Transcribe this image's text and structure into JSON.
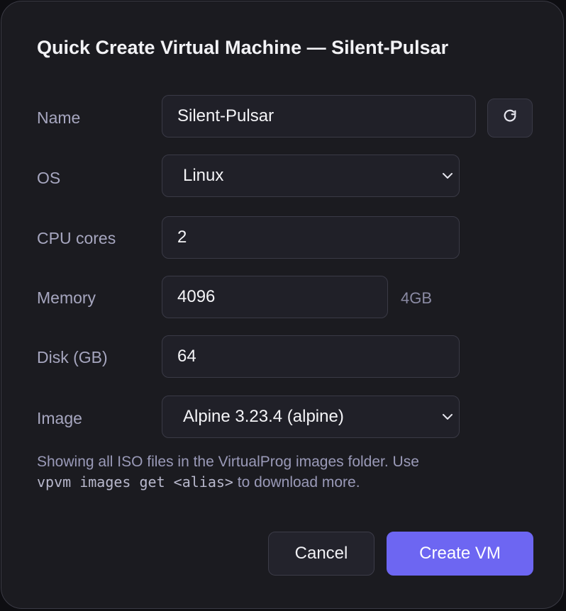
{
  "dialog": {
    "title": "Quick Create Virtual Machine — Silent-Pulsar"
  },
  "form": {
    "name": {
      "label": "Name",
      "value": "Silent-Pulsar"
    },
    "os": {
      "label": "OS",
      "value": "Linux"
    },
    "cpu": {
      "label": "CPU cores",
      "value": "2"
    },
    "memory": {
      "label": "Memory",
      "value": "4096",
      "unit": "4GB"
    },
    "disk": {
      "label": "Disk (GB)",
      "value": "64"
    },
    "image": {
      "label": "Image",
      "value": "Alpine 3.23.4 (alpine)"
    }
  },
  "help": {
    "text_before": "Showing all ISO files in the VirtualProg images folder. Use",
    "command": "vpvm images get <alias>",
    "text_after": " to download more."
  },
  "buttons": {
    "cancel": "Cancel",
    "create": "Create VM"
  },
  "icons": {
    "refresh": "refresh-icon",
    "chevron": "chevron-down-icon"
  },
  "colors": {
    "accent": "#6d66f2",
    "background": "#1b1b20",
    "field": "#202028"
  }
}
